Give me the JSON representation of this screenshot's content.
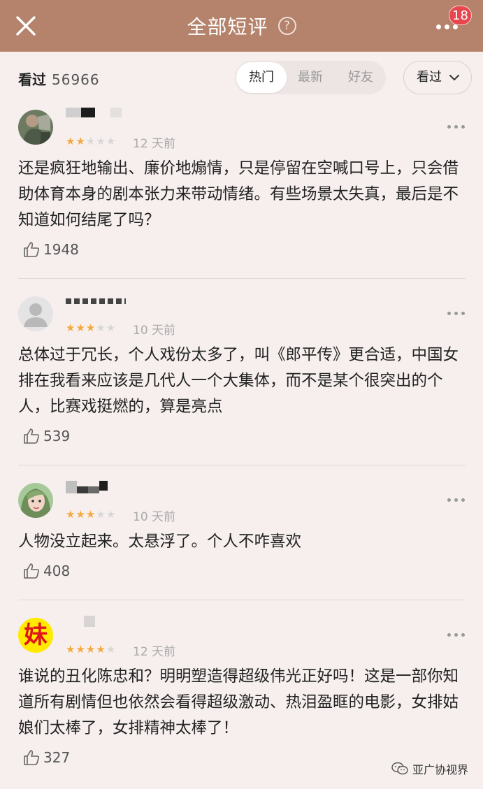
{
  "header": {
    "title": "全部短评",
    "help_symbol": "?",
    "badge_count": "18"
  },
  "filter": {
    "seen_label": "看过",
    "seen_count": "56966",
    "tabs": [
      {
        "label": "热门",
        "active": true
      },
      {
        "label": "最新",
        "active": false
      },
      {
        "label": "好友",
        "active": false
      }
    ],
    "dropdown_label": "看过"
  },
  "reviews": [
    {
      "rating": 2,
      "time": "12 天前",
      "content": "还是疯狂地输出、廉价地煽情，只是停留在空喊口号上，只会借助体育本身的剧本张力来带动情绪。有些场景太失真，最后是不知道如何结尾了吗？",
      "likes": "1948"
    },
    {
      "rating": 3,
      "time": "10 天前",
      "content": "总体过于冗长，个人戏份太多了，叫《郎平传》更合适，中国女排在我看来应该是几代人一个大集体，而不是某个很突出的个人，比赛戏挺燃的，算是亮点",
      "likes": "539"
    },
    {
      "rating": 3,
      "time": "10 天前",
      "content": "人物没立起来。太悬浮了。个人不咋喜欢",
      "likes": "408"
    },
    {
      "rating": 4,
      "avatar_char": "妹",
      "time": "12 天前",
      "content": "谁说的丑化陈忠和？明明塑造得超级伟光正好吗！这是一部你知道所有剧情但也依然会看得超级激动、热泪盈眶的电影，女排姑娘们太棒了，女排精神太棒了！",
      "likes": "327"
    }
  ],
  "watermark": "亚广协视界",
  "colors": {
    "header_bg": "#b5826b",
    "page_bg": "#f6efee",
    "star_on": "#f3a93c",
    "star_off": "#d7d7d7",
    "badge": "#e8454f"
  }
}
